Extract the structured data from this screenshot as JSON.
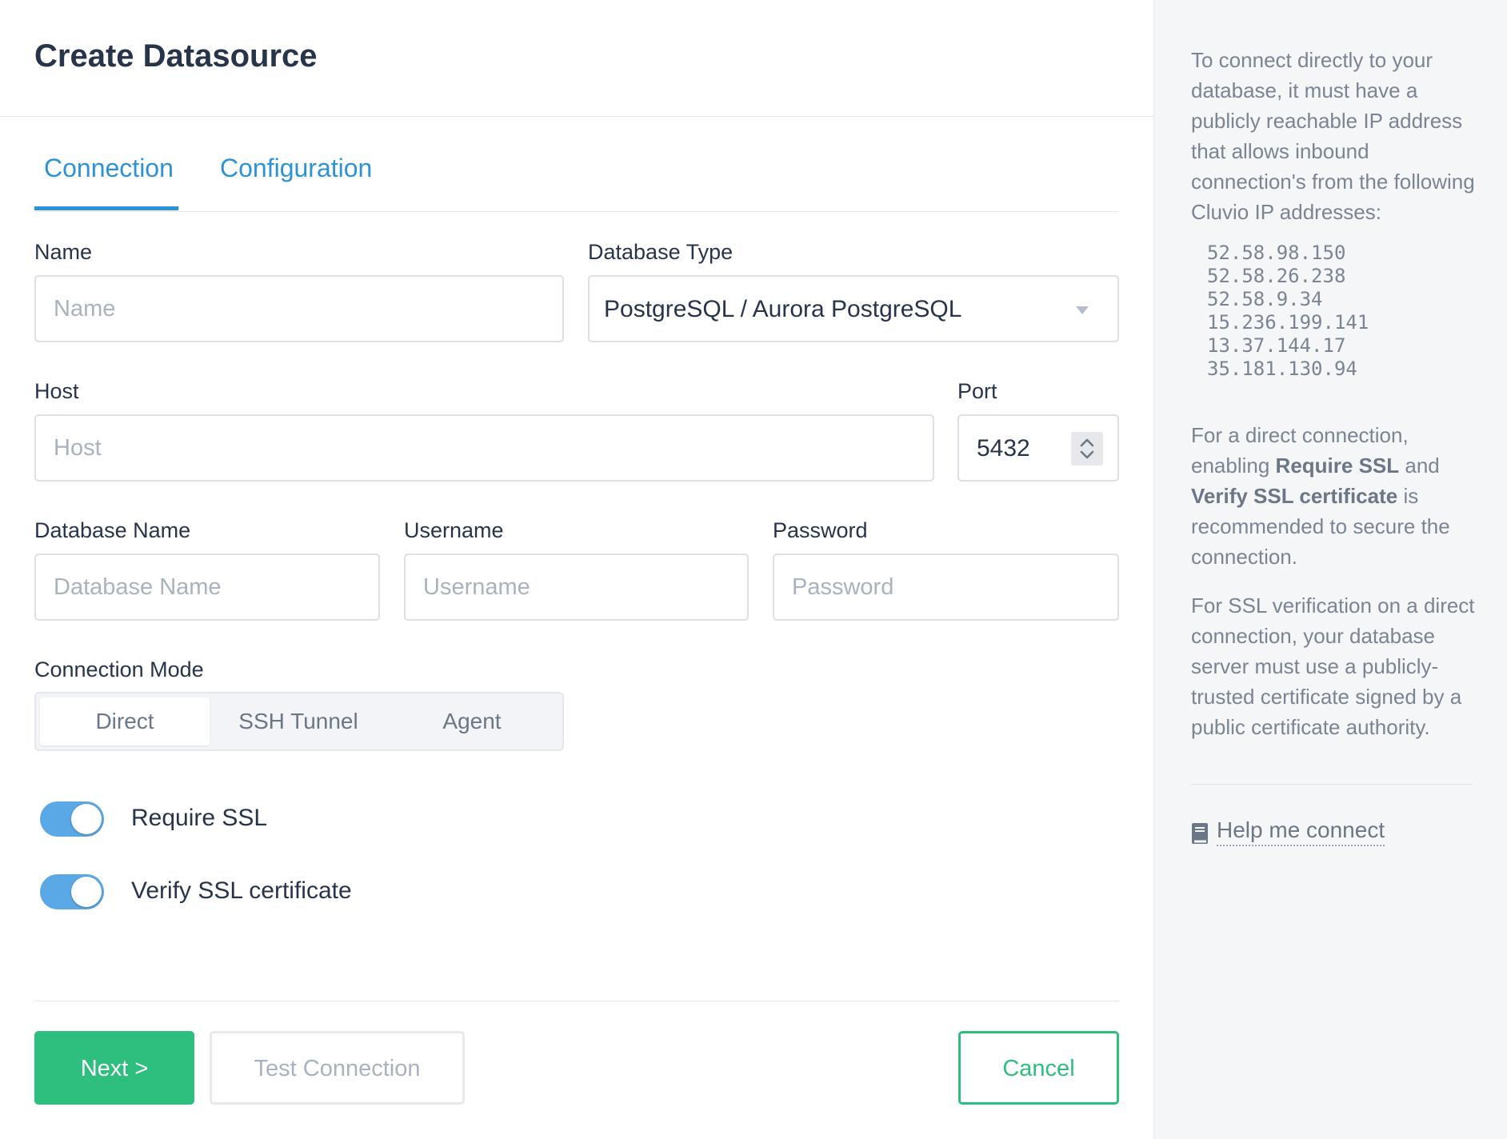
{
  "header": {
    "title": "Create Datasource"
  },
  "tabs": [
    {
      "label": "Connection",
      "active": true
    },
    {
      "label": "Configuration",
      "active": false
    }
  ],
  "form": {
    "name": {
      "label": "Name",
      "placeholder": "Name",
      "value": ""
    },
    "database_type": {
      "label": "Database Type",
      "value": "PostgreSQL / Aurora PostgreSQL"
    },
    "host": {
      "label": "Host",
      "placeholder": "Host",
      "value": ""
    },
    "port": {
      "label": "Port",
      "value": "5432"
    },
    "database_name": {
      "label": "Database Name",
      "placeholder": "Database Name",
      "value": ""
    },
    "username": {
      "label": "Username",
      "placeholder": "Username",
      "value": ""
    },
    "password": {
      "label": "Password",
      "placeholder": "Password",
      "value": ""
    },
    "connection_mode": {
      "label": "Connection Mode",
      "options": [
        "Direct",
        "SSH Tunnel",
        "Agent"
      ],
      "selected": "Direct"
    },
    "require_ssl": {
      "label": "Require SSL",
      "enabled": true
    },
    "verify_ssl": {
      "label": "Verify SSL certificate",
      "enabled": true
    }
  },
  "footer": {
    "next_label": "Next >",
    "test_label": "Test Connection",
    "cancel_label": "Cancel"
  },
  "sidebar": {
    "intro": "To connect directly to your database, it must have a publicly reachable IP address that allows inbound connection's from the following Cluvio IP addresses:",
    "ips": [
      "52.58.98.150",
      "52.58.26.238",
      "52.58.9.34",
      "15.236.199.141",
      "13.37.144.17",
      "35.181.130.94"
    ],
    "ssl_note": {
      "pre": "For a direct connection, enabling ",
      "bold1": "Require SSL",
      "mid": " and ",
      "bold2": "Verify SSL certificate",
      "post": " is recommended to secure the connection."
    },
    "verification_note": "For SSL verification on a direct connection, your database server must use a publicly-trusted certificate signed by a public certificate authority.",
    "help_link": "Help me connect"
  },
  "colors": {
    "accent_blue": "#2d93d8",
    "toggle_blue": "#5aa9e6",
    "primary_green": "#2ebe7e",
    "sidebar_bg": "#f5f6f8"
  },
  "icons": [
    "chevron-up-down-icon",
    "dropdown-caret-icon",
    "book-icon"
  ]
}
